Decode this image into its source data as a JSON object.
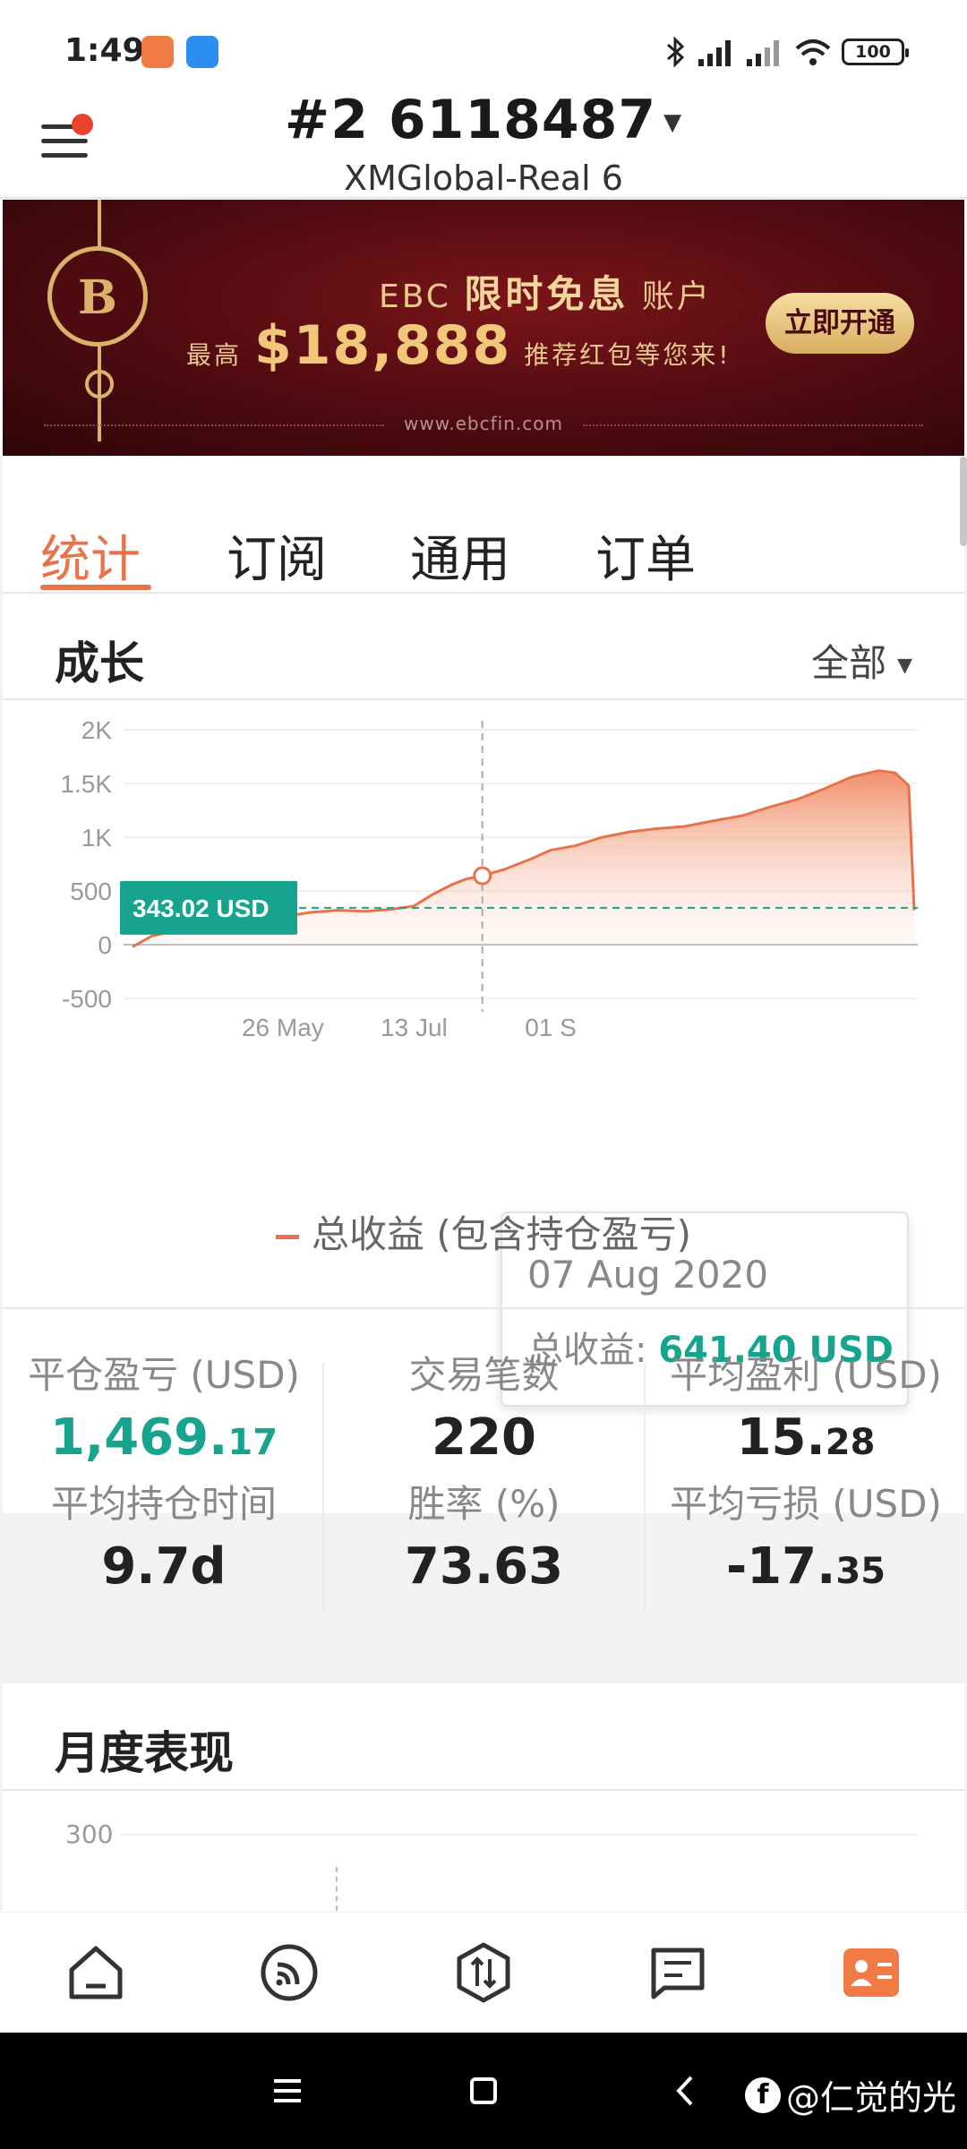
{
  "status_bar": {
    "time": "1:49",
    "battery": "100",
    "icons": [
      "bluetooth-icon",
      "signal-icon",
      "signal-icon",
      "wifi-icon",
      "battery-icon"
    ]
  },
  "header": {
    "account_title": "#2  6118487",
    "account_server": "XMGlobal-Real 6"
  },
  "banner": {
    "brand_line_prefix": "EBC",
    "brand_line_highlight": "限时免息",
    "brand_line_suffix": "账户",
    "amount_prefix": "最高",
    "amount": "$18,888",
    "amount_suffix": "推荐红包等您来!",
    "cta": "立即开通",
    "url": "www.ebcfin.com",
    "colors": {
      "background": "#4e0b10",
      "gold": "#d9b36a"
    }
  },
  "tabs": [
    {
      "label": "统计",
      "active": true
    },
    {
      "label": "订阅",
      "active": false
    },
    {
      "label": "通用",
      "active": false
    },
    {
      "label": "订单",
      "active": false
    }
  ],
  "growth": {
    "title": "成长",
    "filter": "全部"
  },
  "chart_data": {
    "type": "area",
    "title": "",
    "series": [
      {
        "name": "总收益 (包含持仓盈亏)",
        "color": "#e8734a",
        "x": [
          "2020-04-01",
          "2020-04-08",
          "2020-04-15",
          "2020-04-22",
          "2020-05-01",
          "2020-05-10",
          "2020-05-20",
          "2020-05-26",
          "2020-06-05",
          "2020-06-15",
          "2020-06-25",
          "2020-07-05",
          "2020-07-13",
          "2020-07-20",
          "2020-07-27",
          "2020-08-01",
          "2020-08-07",
          "2020-08-15",
          "2020-08-25",
          "2020-09-01",
          "2020-09-10",
          "2020-09-20",
          "2020-09-30",
          "2020-10-10",
          "2020-10-20",
          "2020-10-30",
          "2020-11-10",
          "2020-11-20",
          "2020-11-30",
          "2020-12-10",
          "2020-12-20",
          "2020-12-30",
          "2021-01-05",
          "2021-01-10",
          "2021-01-12"
        ],
        "values": [
          -20,
          80,
          120,
          140,
          180,
          210,
          230,
          260,
          300,
          320,
          310,
          330,
          360,
          470,
          560,
          610,
          641.4,
          700,
          800,
          880,
          920,
          1000,
          1050,
          1080,
          1100,
          1150,
          1200,
          1280,
          1350,
          1450,
          1560,
          1620,
          1600,
          1480,
          320
        ]
      }
    ],
    "y_ticks": [
      "2K",
      "1.5K",
      "1K",
      "500",
      "0",
      "-500"
    ],
    "x_ticks": [
      "26 May",
      "13 Jul",
      "01 S"
    ],
    "ylim": [
      -500,
      2000
    ],
    "grid": true,
    "reference_line_label": "343.02 USD",
    "reference_value": 343.02,
    "crosshair_x": "2020-08-07",
    "legend_position": "bottom"
  },
  "tooltip": {
    "date": "07 Aug 2020",
    "label": "总收益:",
    "value": "641.40 USD"
  },
  "stats": {
    "closed_pl_label": "平仓盈亏 (USD)",
    "closed_pl_int": "1,469.",
    "closed_pl_dec": "17",
    "avg_hold_label": "平均持仓时间",
    "avg_hold": "9.7d",
    "trades_label": "交易笔数",
    "trades": "220",
    "win_rate_label": "胜率 (%)",
    "win_rate": "73.63",
    "avg_profit_label": "平均盈利 (USD)",
    "avg_profit_int": "15.",
    "avg_profit_dec": "28",
    "avg_loss_label": "平均亏损 (USD)",
    "avg_loss_int": "-17.",
    "avg_loss_dec": "35"
  },
  "monthly": {
    "title": "月度表现",
    "y_tick": "300"
  },
  "bottom_nav": [
    "home-icon",
    "feed-icon",
    "trade-icon",
    "messages-icon",
    "profile-icon"
  ],
  "system_nav": {
    "watermark": "@仁觉的光"
  }
}
